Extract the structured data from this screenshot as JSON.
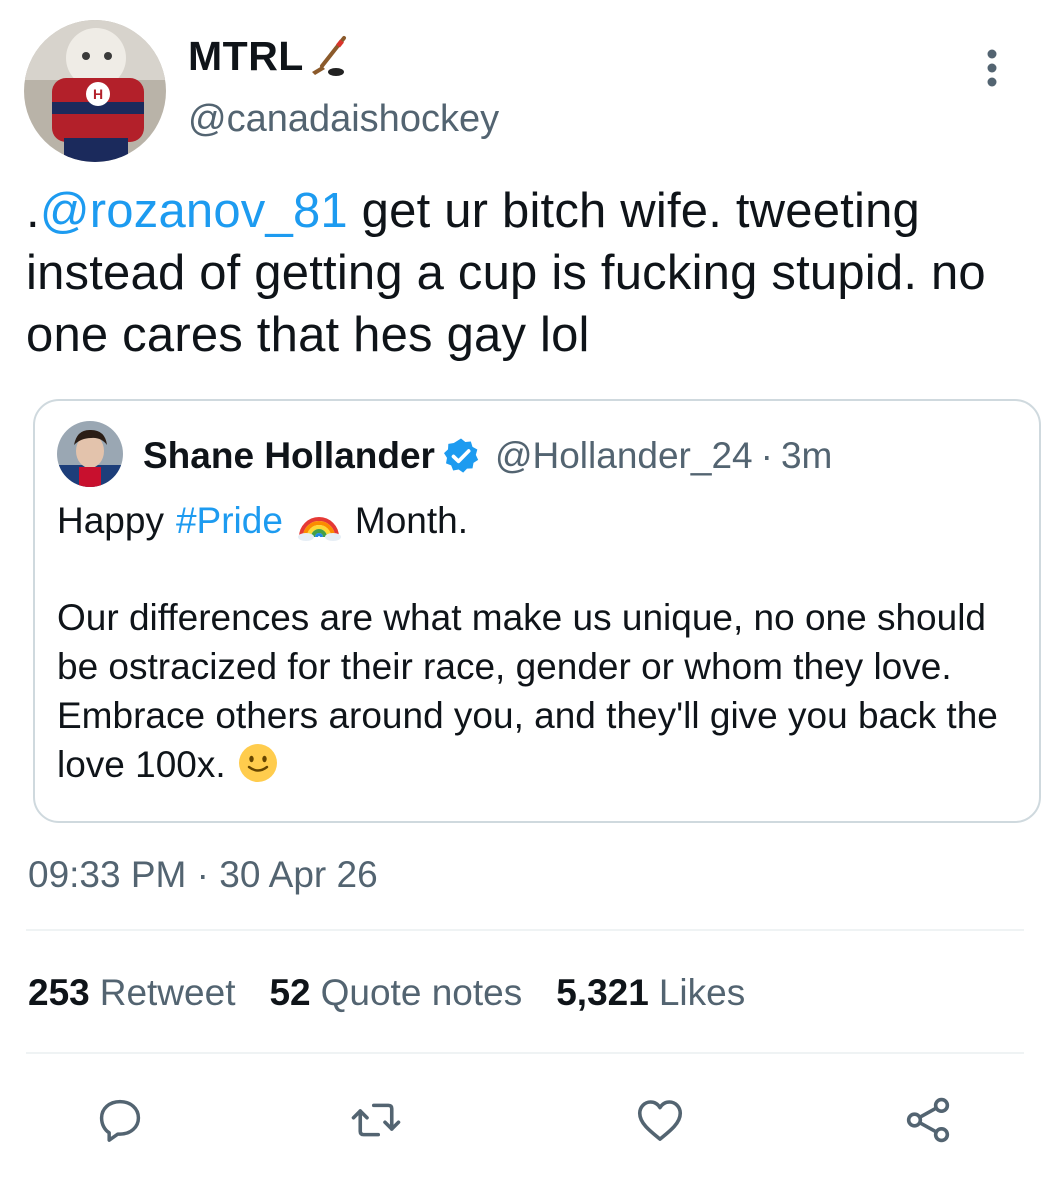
{
  "author": {
    "display_name": "MTRL",
    "name_emoji": "hockey-stick-and-puck-icon",
    "handle": "@canadaishockey"
  },
  "tweet": {
    "prefix": ".",
    "mention": "@rozanov_81",
    "text_after_mention": " get ur bitch wife. tweeting instead of getting a cup is fucking stupid. no one cares that hes gay lol"
  },
  "quoted_tweet": {
    "name": "Shane Hollander",
    "verified_icon": "verified-badge-icon",
    "handle": "@Hollander_24",
    "separator": "·",
    "time": "3m",
    "line1_before": "Happy",
    "hashtag": "#Pride",
    "rainbow_icon": "rainbow-icon",
    "line1_after": "Month.",
    "body": "Our differences are what make us unique, no one should be ostracized for their race, gender or whom they love. Embrace others around you, and they'll give you back the love 100x.",
    "smile_icon": "slightly-smiling-face-icon"
  },
  "timestamp": "09:33 PM · 30 Apr 26",
  "stats": {
    "retweets": {
      "count": "253",
      "label": "Retweet"
    },
    "quotes": {
      "count": "52",
      "label": "Quote notes"
    },
    "likes": {
      "count": "5,321",
      "label": "Likes"
    }
  },
  "actions": [
    "reply-icon",
    "retweet-icon",
    "like-icon",
    "share-icon"
  ],
  "colors": {
    "text": "#0f1419",
    "secondary": "#536471",
    "link": "#1d9bf0",
    "border": "#cfd9de",
    "divider": "#eff3f4"
  }
}
